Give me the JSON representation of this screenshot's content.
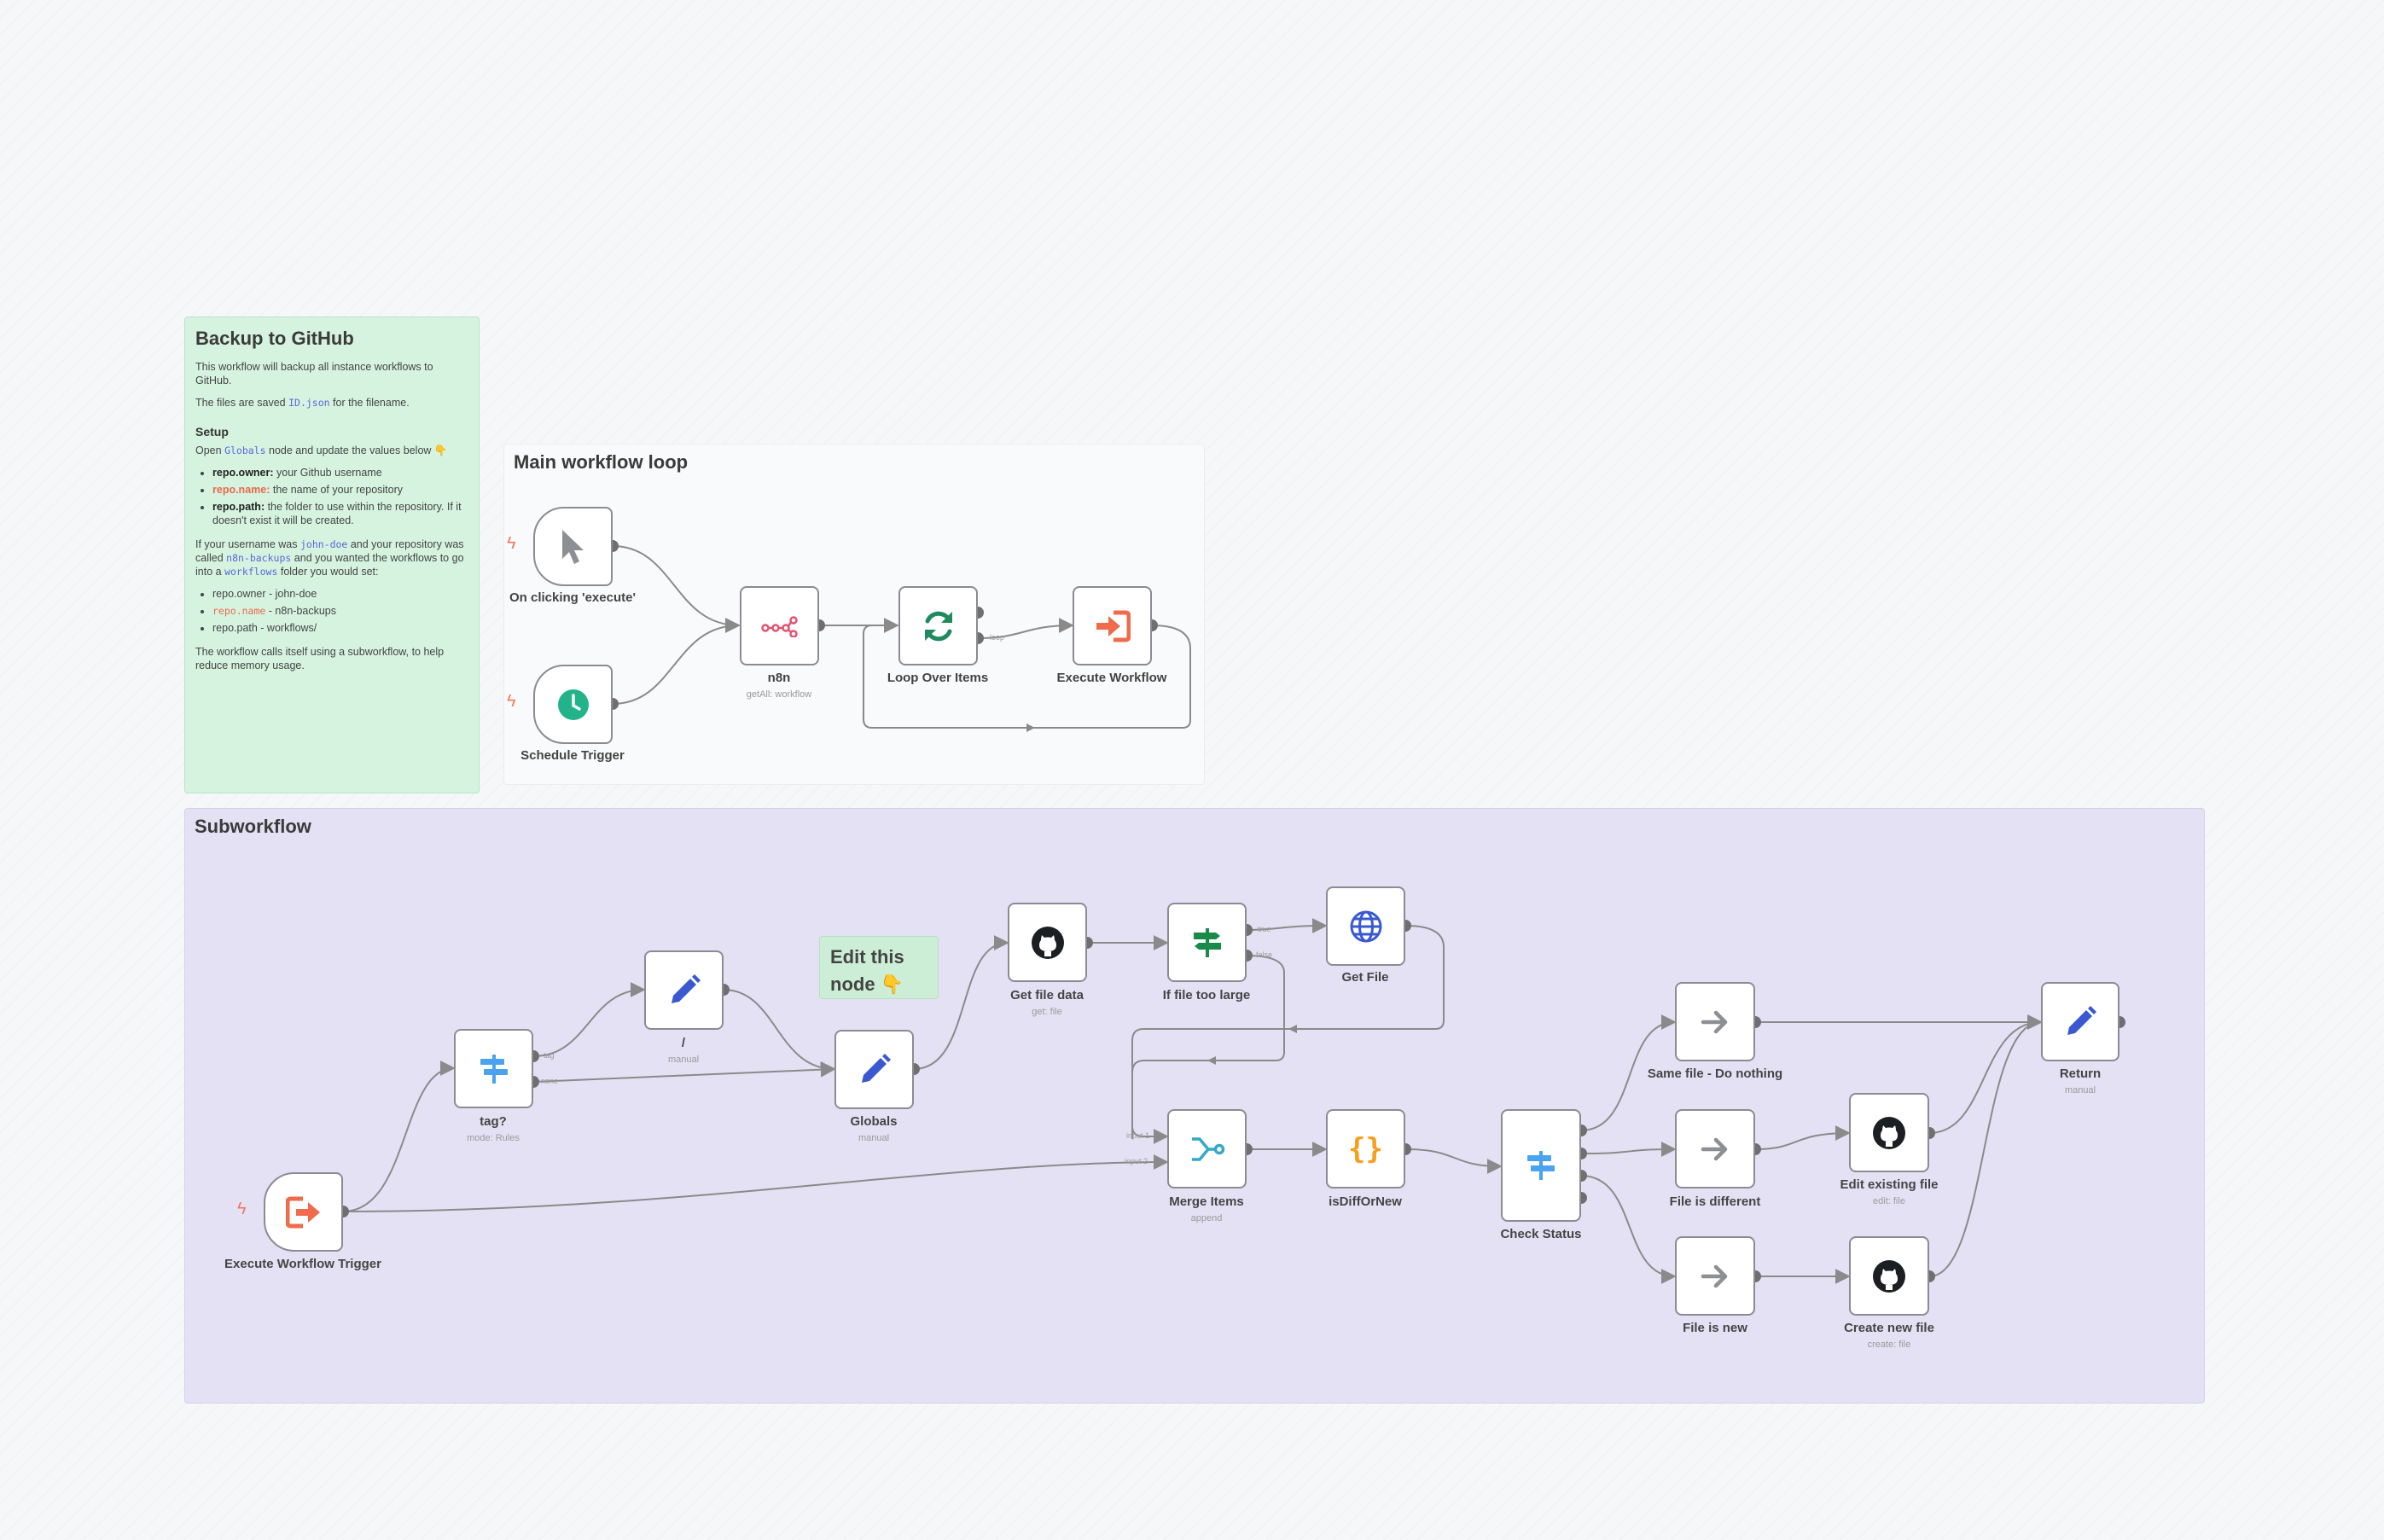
{
  "colors": {
    "edge": "#8a8a8a",
    "port": "#6f6f6f",
    "node_border": "#8b8b93",
    "note_green": "#d6f3e0",
    "note_lavender": "#e5e1f5",
    "trigger_bolt": "#f07a5e"
  },
  "notes": {
    "backup": {
      "title": "Backup to GitHub",
      "intro": "This workflow will backup all instance workflows to GitHub.",
      "files_pre": "The files are saved ",
      "files_code": "ID.json",
      "files_post": " for the filename.",
      "setup_title": "Setup",
      "open_pre": "Open ",
      "open_code": "Globals",
      "open_post": " node and update the values below 👇",
      "bullets": [
        {
          "key": "repo.owner:",
          "text": " your Github username"
        },
        {
          "key": "repo.name:",
          "text": " the name of your repository"
        },
        {
          "key": "repo.path:",
          "text": " the folder to use within the repository. If it doesn't exist it will be created."
        }
      ],
      "ex_1": "If your username was ",
      "ex_code1": "john-doe",
      "ex_2": " and your repository was called ",
      "ex_code2": "n8n-backups",
      "ex_3": " and you wanted the workflows to go into a ",
      "ex_code3": "workflows",
      "ex_4": " folder you would set:",
      "example_bullets": [
        {
          "key": "repo.owner",
          "text": " - john-doe"
        },
        {
          "key": "repo.name",
          "text": " - n8n-backups"
        },
        {
          "key": "repo.path",
          "text": " - workflows/"
        }
      ],
      "footer": "The workflow calls itself using a subworkflow, to help reduce memory usage."
    },
    "main_title": "Main workflow loop",
    "sub_title": "Subworkflow",
    "edit_line1": "Edit this",
    "edit_line2": "node 👇"
  },
  "nodes": {
    "on_clicking": {
      "label": "On clicking 'execute'",
      "icon": "cursor-icon"
    },
    "schedule": {
      "label": "Schedule Trigger",
      "icon": "clock-icon"
    },
    "n8n": {
      "label": "n8n",
      "sub": "getAll: workflow",
      "icon": "n8n-icon"
    },
    "loop": {
      "label": "Loop Over Items",
      "icon": "loop-icon",
      "port_loop": "loop"
    },
    "execute_wf": {
      "label": "Execute Workflow",
      "icon": "execute-workflow-icon"
    },
    "exec_trigger": {
      "label": "Execute Workflow Trigger",
      "icon": "workflow-trigger-icon"
    },
    "tag": {
      "label": "tag?",
      "sub": "mode: Rules",
      "icon": "switch-icon",
      "port_tag": "tag",
      "port_none": "none"
    },
    "slash": {
      "label": "/",
      "sub": "manual",
      "icon": "pencil-icon"
    },
    "globals": {
      "label": "Globals",
      "sub": "manual",
      "icon": "pencil-icon"
    },
    "get_file_data": {
      "label": "Get file data",
      "sub": "get: file",
      "icon": "github-icon"
    },
    "if_large": {
      "label": "If file too large",
      "icon": "if-icon",
      "port_true": "true",
      "port_false": "false"
    },
    "get_file": {
      "label": "Get File",
      "icon": "globe-icon"
    },
    "merge": {
      "label": "Merge Items",
      "sub": "append",
      "icon": "merge-icon",
      "port_in1": "input 1",
      "port_in2": "input 2"
    },
    "isdiff": {
      "label": "isDiffOrNew",
      "icon": "code-icon"
    },
    "check_status": {
      "label": "Check Status",
      "icon": "switch-icon"
    },
    "same_file": {
      "label": "Same file - Do nothing",
      "icon": "arrow-right-icon"
    },
    "file_diff": {
      "label": "File is different",
      "icon": "arrow-right-icon"
    },
    "file_new": {
      "label": "File is new",
      "icon": "arrow-right-icon"
    },
    "edit_existing": {
      "label": "Edit existing file",
      "sub": "edit: file",
      "icon": "github-icon"
    },
    "create_new": {
      "label": "Create new file",
      "sub": "create: file",
      "icon": "github-icon"
    },
    "return": {
      "label": "Return",
      "sub": "manual",
      "icon": "pencil-icon"
    }
  }
}
